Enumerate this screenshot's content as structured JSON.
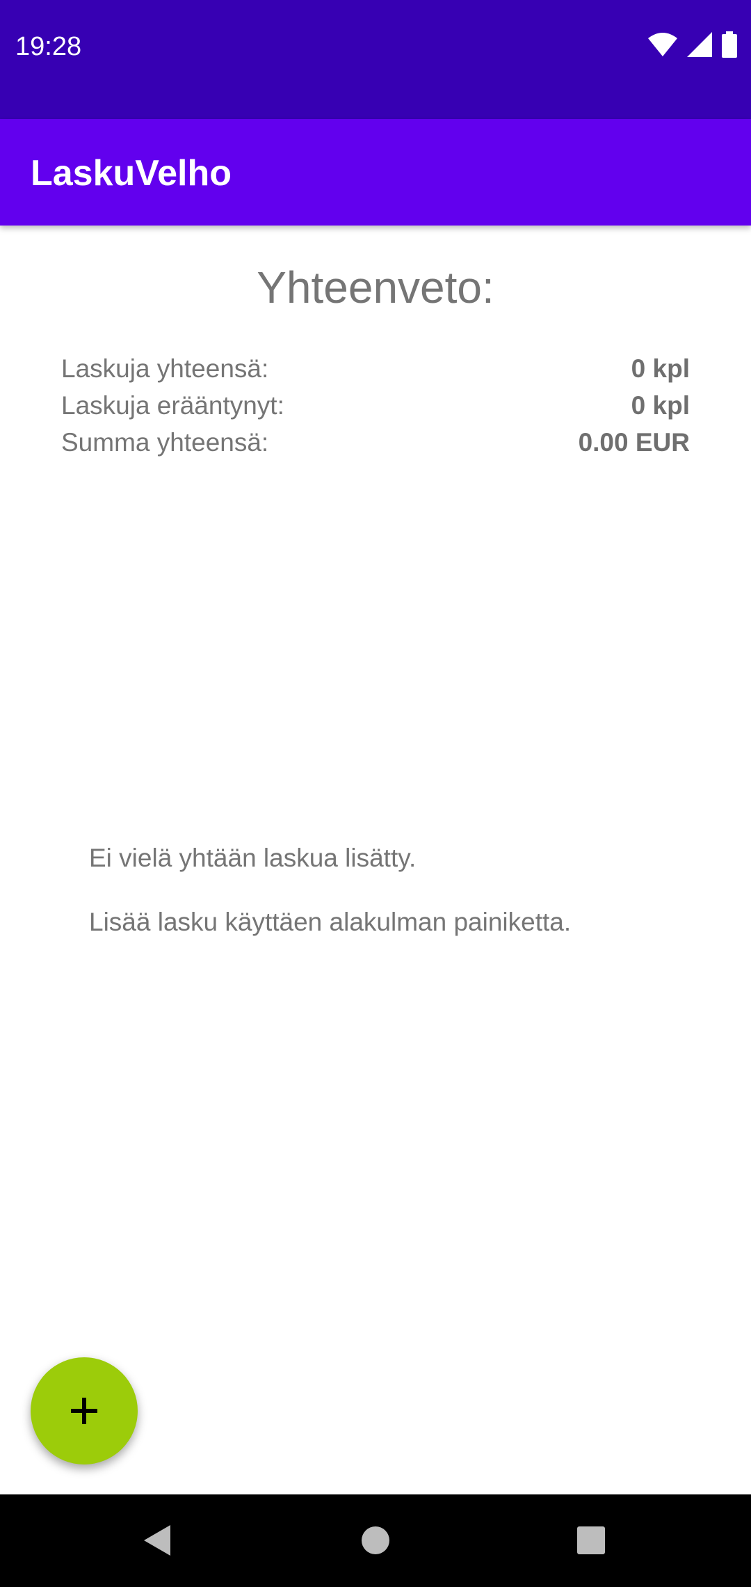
{
  "status_bar": {
    "time": "19:28",
    "icons": [
      "wifi-icon",
      "cell-signal-icon",
      "battery-icon"
    ]
  },
  "app_bar": {
    "title": "LaskuVelho"
  },
  "summary": {
    "title": "Yhteenveto:",
    "rows": [
      {
        "label": "Laskuja yhteensä:",
        "value": "0 kpl"
      },
      {
        "label": "Laskuja erääntynyt:",
        "value": "0 kpl"
      },
      {
        "label": "Summa yhteensä:",
        "value": "0.00 EUR"
      }
    ]
  },
  "empty_state": {
    "line1": "Ei vielä yhtään laskua lisätty.",
    "line2": "Lisää lasku käyttäen alakulman painiketta."
  },
  "fab": {
    "icon": "plus-icon"
  },
  "nav_bar": {
    "buttons": [
      "back-icon",
      "home-icon",
      "recents-icon"
    ]
  },
  "colors": {
    "status_bar": "#3700b3",
    "app_bar": "#6200ee",
    "fab": "#9ccc0a",
    "text_secondary": "#757575"
  }
}
